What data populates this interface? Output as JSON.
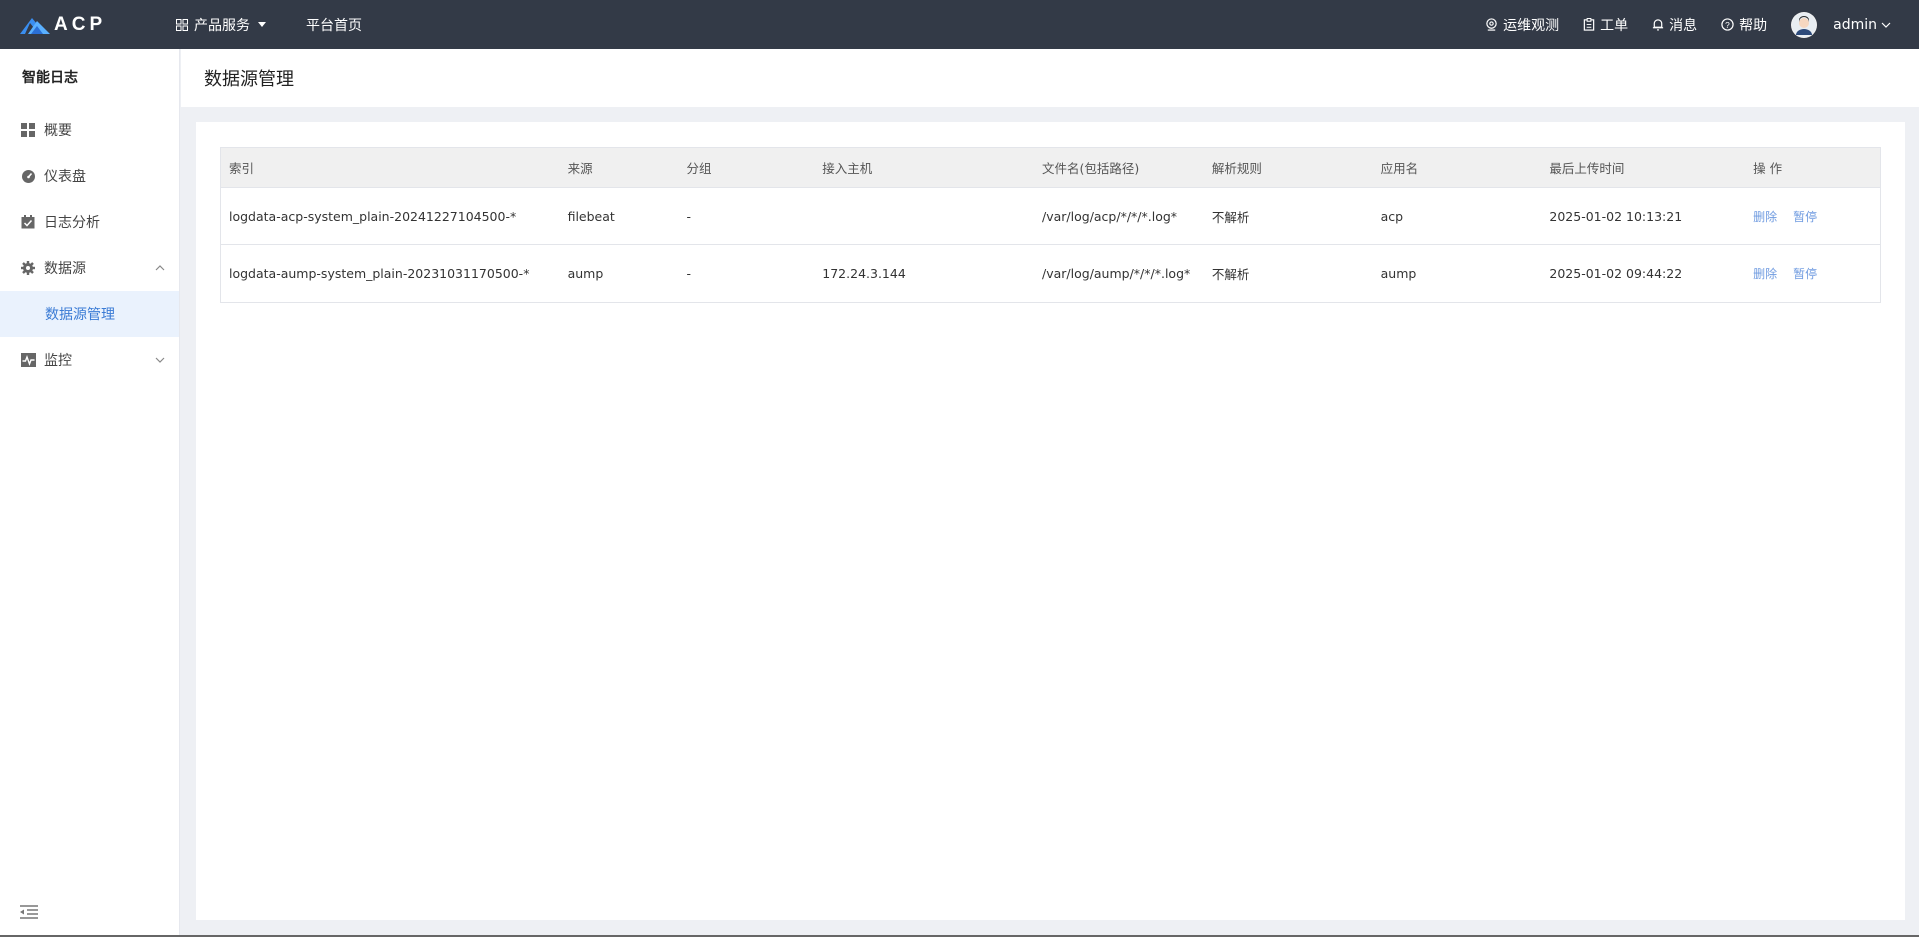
{
  "topbar": {
    "logo_text": "ACP",
    "nav": [
      {
        "label": "产品服务"
      },
      {
        "label": "平台首页"
      }
    ],
    "right": [
      {
        "label": "运维观测"
      },
      {
        "label": "工单"
      },
      {
        "label": "消息"
      },
      {
        "label": "帮助"
      }
    ],
    "username": "admin"
  },
  "sidebar": {
    "title": "智能日志",
    "items": [
      {
        "label": "概要"
      },
      {
        "label": "仪表盘"
      },
      {
        "label": "日志分析"
      },
      {
        "label": "数据源"
      },
      {
        "label": "数据源管理"
      },
      {
        "label": "监控"
      }
    ]
  },
  "page": {
    "title": "数据源管理"
  },
  "table": {
    "headers": [
      "索引",
      "来源",
      "分组",
      "接入主机",
      "文件名(包括路径)",
      "解析规则",
      "应用名",
      "最后上传时间",
      "操 作"
    ],
    "rows": [
      {
        "cells": [
          "logdata-acp-system_plain-20241227104500-*",
          "filebeat",
          "-",
          "",
          "/var/log/acp/*/*/*.log*",
          "不解析",
          "acp",
          "2025-01-02 10:13:21"
        ],
        "actions": [
          "删除",
          "暂停"
        ]
      },
      {
        "cells": [
          "logdata-aump-system_plain-20231031170500-*",
          "aump",
          "-",
          "172.24.3.144",
          "/var/log/aump/*/*/*.log*",
          "不解析",
          "aump",
          "2025-01-02 09:44:22"
        ],
        "actions": [
          "删除",
          "暂停"
        ]
      }
    ]
  },
  "colors": {
    "topbar_bg": "#333a47",
    "accent": "#3a7bd5",
    "link": "#6f9be0"
  }
}
